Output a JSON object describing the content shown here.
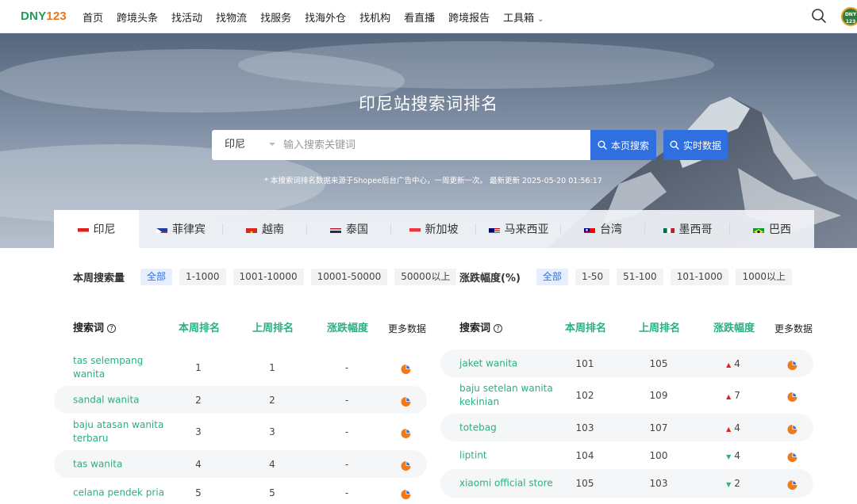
{
  "nav": {
    "logo_a": "DNY",
    "logo_b": "123",
    "items": [
      "首页",
      "跨境头条",
      "找活动",
      "找物流",
      "找服务",
      "找海外仓",
      "找机构",
      "看直播",
      "跨境报告",
      "工具箱"
    ],
    "avatar_text": "DNY 123"
  },
  "hero": {
    "title": "印尼站搜索词排名",
    "country_value": "印尼",
    "search_placeholder": "输入搜索关键词",
    "btn_page": "本页搜索",
    "btn_live": "实时数据",
    "note": "* 本搜索词排名数据来源于Shopee后台广告中心，一周更新一次。 最新更新 2025-05-20 01:56:17"
  },
  "tabs": [
    {
      "label": "印尼",
      "flag": "id",
      "active": true
    },
    {
      "label": "菲律宾",
      "flag": "ph",
      "active": false
    },
    {
      "label": "越南",
      "flag": "vn",
      "active": false
    },
    {
      "label": "泰国",
      "flag": "th",
      "active": false
    },
    {
      "label": "新加坡",
      "flag": "sg",
      "active": false
    },
    {
      "label": "马来西亚",
      "flag": "my",
      "active": false
    },
    {
      "label": "台湾",
      "flag": "tw",
      "active": false
    },
    {
      "label": "墨西哥",
      "flag": "mx",
      "active": false
    },
    {
      "label": "巴西",
      "flag": "br",
      "active": false
    }
  ],
  "filters": {
    "volume": {
      "label": "本周搜索量",
      "chips": [
        "全部",
        "1-1000",
        "1001-10000",
        "10001-50000",
        "50000以上"
      ],
      "active": 0
    },
    "change": {
      "label": "涨跌幅度(%)",
      "chips": [
        "全部",
        "1-50",
        "51-100",
        "101-1000",
        "1000以上"
      ],
      "active": 0
    }
  },
  "table_headers": {
    "keyword": "搜索词",
    "help": "?",
    "this_week": "本周排名",
    "last_week": "上周排名",
    "change": "涨跌幅度",
    "more": "更多数据"
  },
  "left_rows": [
    {
      "keyword": "tas selempang wanita",
      "this_week": "1",
      "last_week": "1",
      "change": "-",
      "dir": "none"
    },
    {
      "keyword": "sandal wanita",
      "this_week": "2",
      "last_week": "2",
      "change": "-",
      "dir": "none"
    },
    {
      "keyword": "baju atasan wanita terbaru",
      "this_week": "3",
      "last_week": "3",
      "change": "-",
      "dir": "none"
    },
    {
      "keyword": "tas wanita",
      "this_week": "4",
      "last_week": "4",
      "change": "-",
      "dir": "none"
    },
    {
      "keyword": "celana pendek pria",
      "this_week": "5",
      "last_week": "5",
      "change": "-",
      "dir": "none"
    }
  ],
  "right_rows": [
    {
      "keyword": "jaket wanita",
      "this_week": "101",
      "last_week": "105",
      "change": "4",
      "dir": "up"
    },
    {
      "keyword": "baju setelan wanita kekinian",
      "this_week": "102",
      "last_week": "109",
      "change": "7",
      "dir": "up"
    },
    {
      "keyword": "totebag",
      "this_week": "103",
      "last_week": "107",
      "change": "4",
      "dir": "up"
    },
    {
      "keyword": "liptint",
      "this_week": "104",
      "last_week": "100",
      "change": "4",
      "dir": "down"
    },
    {
      "keyword": "xiaomi official store",
      "this_week": "105",
      "last_week": "103",
      "change": "2",
      "dir": "down"
    }
  ],
  "colors": {
    "accent": "#2f6fe0",
    "green": "#2bb07f",
    "pie": "#f07a1a"
  }
}
